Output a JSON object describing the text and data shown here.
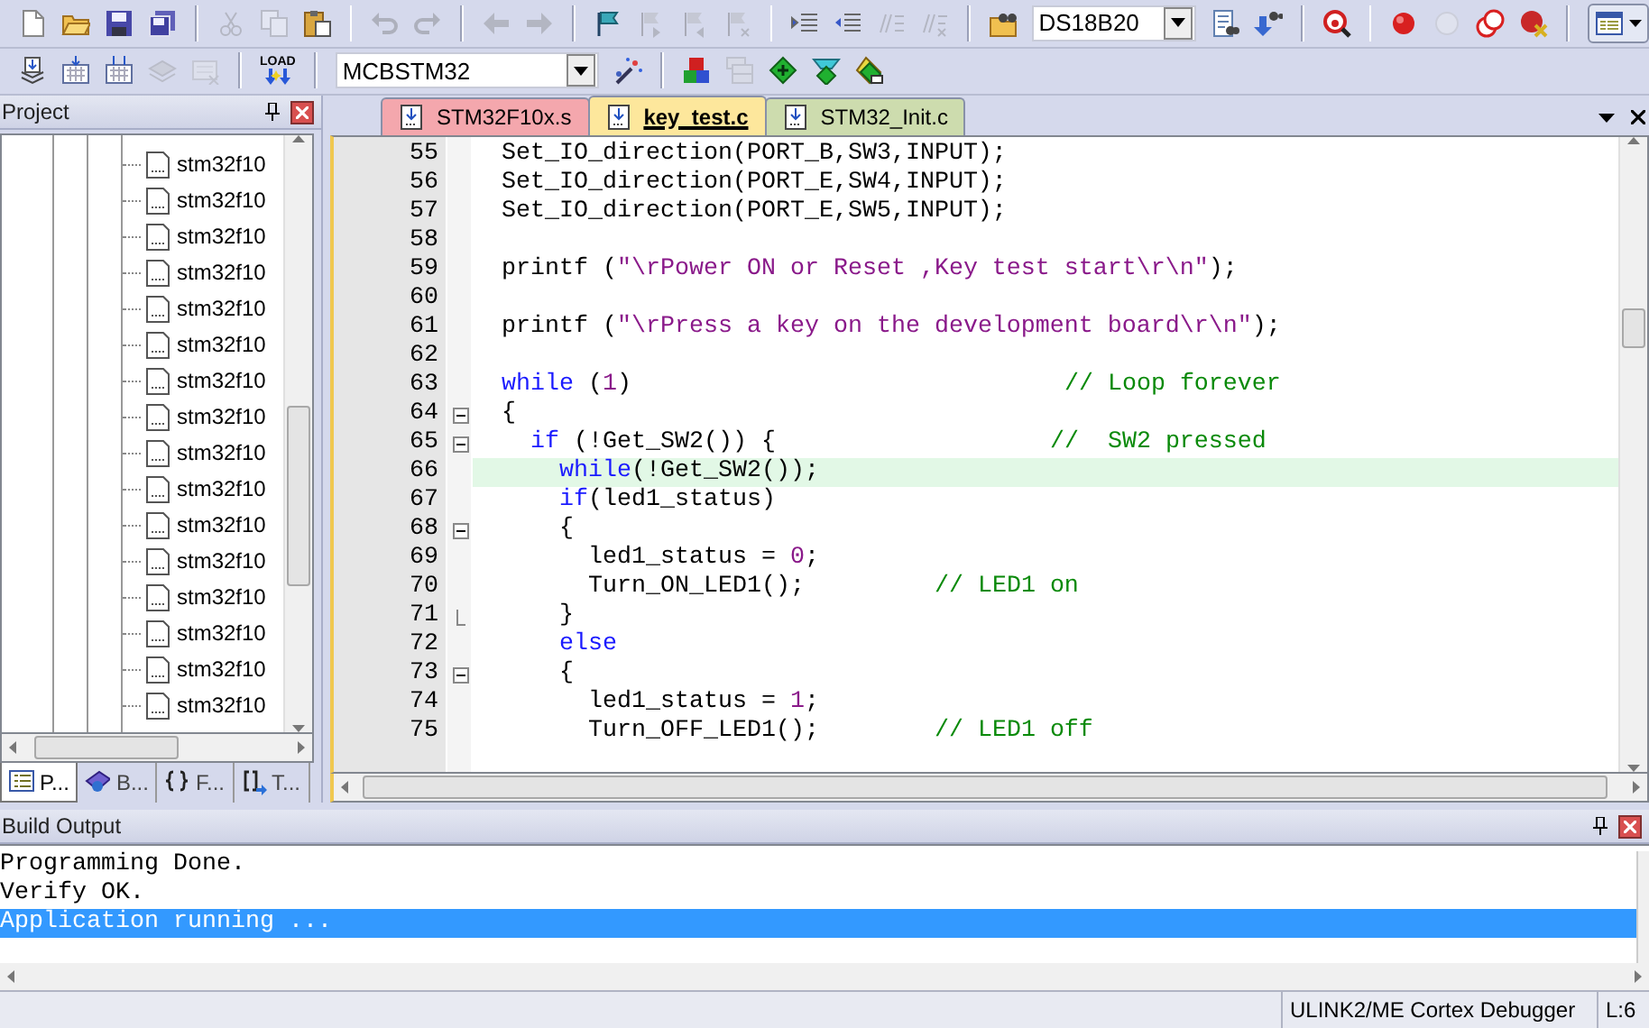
{
  "toolbar_1": {
    "items": [
      {
        "kind": "button",
        "disabled": false
      },
      {
        "kind": "button",
        "disabled": false
      },
      {
        "kind": "button",
        "disabled": false
      },
      {
        "kind": "button",
        "disabled": false
      },
      {
        "kind": "separator"
      },
      {
        "kind": "button",
        "disabled": true
      },
      {
        "kind": "button",
        "disabled": true
      },
      {
        "kind": "button",
        "disabled": false
      },
      {
        "kind": "separator"
      },
      {
        "kind": "button",
        "disabled": true
      },
      {
        "kind": "button",
        "disabled": true
      },
      {
        "kind": "separator"
      },
      {
        "kind": "button",
        "disabled": true
      },
      {
        "kind": "button",
        "disabled": true
      },
      {
        "kind": "separator"
      },
      {
        "kind": "button",
        "disabled": false
      },
      {
        "kind": "button",
        "disabled": true
      },
      {
        "kind": "button",
        "disabled": true
      },
      {
        "kind": "button",
        "disabled": true
      },
      {
        "kind": "separator"
      },
      {
        "kind": "button",
        "disabled": false
      },
      {
        "kind": "button",
        "disabled": false
      },
      {
        "kind": "button",
        "disabled": true
      },
      {
        "kind": "button",
        "disabled": true
      },
      {
        "kind": "separator"
      },
      {
        "kind": "button",
        "disabled": false
      },
      {
        "kind": "dropdown",
        "value": "DS18B20"
      },
      {
        "kind": "button",
        "disabled": false
      },
      {
        "kind": "button",
        "disabled": false
      },
      {
        "kind": "separator"
      },
      {
        "kind": "button",
        "disabled": false
      },
      {
        "kind": "separator"
      },
      {
        "kind": "button",
        "disabled": false
      },
      {
        "kind": "button",
        "disabled": true
      },
      {
        "kind": "button",
        "disabled": false
      },
      {
        "kind": "button",
        "disabled": false
      },
      {
        "kind": "separator"
      },
      {
        "kind": "menu_button",
        "disabled": false
      }
    ]
  },
  "toolbar_2": {
    "items": [
      {
        "kind": "button",
        "disabled": false
      },
      {
        "kind": "button",
        "disabled": false
      },
      {
        "kind": "button",
        "disabled": false
      },
      {
        "kind": "button",
        "disabled": true
      },
      {
        "kind": "button",
        "disabled": true
      },
      {
        "kind": "separator"
      },
      {
        "kind": "load",
        "label": "LOAD",
        "disabled": false
      },
      {
        "kind": "separator"
      },
      {
        "kind": "dropdown",
        "value": "MCBSTM32"
      },
      {
        "kind": "button",
        "disabled": false
      },
      {
        "kind": "separator"
      },
      {
        "kind": "button",
        "disabled": false
      },
      {
        "kind": "button",
        "disabled": true
      },
      {
        "kind": "button",
        "disabled": false
      },
      {
        "kind": "button",
        "disabled": false
      },
      {
        "kind": "button",
        "disabled": false
      }
    ]
  },
  "project": {
    "title": "Project",
    "items": [
      {
        "label": "stm32f10"
      },
      {
        "label": "stm32f10"
      },
      {
        "label": "stm32f10"
      },
      {
        "label": "stm32f10"
      },
      {
        "label": "stm32f10"
      },
      {
        "label": "stm32f10"
      },
      {
        "label": "stm32f10"
      },
      {
        "label": "stm32f10"
      },
      {
        "label": "stm32f10"
      },
      {
        "label": "stm32f10"
      },
      {
        "label": "stm32f10"
      },
      {
        "label": "stm32f10"
      },
      {
        "label": "stm32f10"
      },
      {
        "label": "stm32f10"
      },
      {
        "label": "stm32f10"
      },
      {
        "label": "stm32f10"
      }
    ],
    "tabs": [
      {
        "label": "P...",
        "selected": true
      },
      {
        "label": "B...",
        "selected": false
      },
      {
        "label": "F...",
        "selected": false
      },
      {
        "label": "T...",
        "selected": false
      }
    ]
  },
  "editor": {
    "tabs": [
      {
        "label": "STM32F10x.s",
        "color": "#f4a7ad",
        "selected": false
      },
      {
        "label": "key_test.c",
        "color": "#fde79c",
        "selected": true
      },
      {
        "label": "STM32_Init.c",
        "color": "#cddcae",
        "selected": false
      }
    ],
    "lines": [
      {
        "number": "55",
        "segments": [
          {
            "kind": "plain",
            "text": "  Set_IO_direction(PORT_B,SW3,INPUT);"
          }
        ]
      },
      {
        "number": "56",
        "segments": [
          {
            "kind": "plain",
            "text": "  Set_IO_direction(PORT_E,SW4,INPUT);"
          }
        ]
      },
      {
        "number": "57",
        "segments": [
          {
            "kind": "plain",
            "text": "  Set_IO_direction(PORT_E,SW5,INPUT);"
          }
        ]
      },
      {
        "number": "58"
      },
      {
        "number": "59",
        "segments": [
          {
            "kind": "plain",
            "text": "  printf ("
          },
          {
            "kind": "string",
            "text": "\"\\rPower ON or Reset ,Key test start\\r\\n\""
          },
          {
            "kind": "plain",
            "text": ");"
          }
        ]
      },
      {
        "number": "60"
      },
      {
        "number": "61",
        "segments": [
          {
            "kind": "plain",
            "text": "  printf ("
          },
          {
            "kind": "string",
            "text": "\"\\rPress a key on the development board\\r\\n\""
          },
          {
            "kind": "plain",
            "text": ");"
          }
        ]
      },
      {
        "number": "62"
      },
      {
        "number": "63",
        "segments": [
          {
            "kind": "keyword",
            "text": "  while"
          },
          {
            "kind": "plain",
            "text": " ("
          },
          {
            "kind": "number",
            "text": "1"
          },
          {
            "kind": "plain",
            "text": ")                              "
          },
          {
            "kind": "comment",
            "text": "// Loop forever"
          }
        ]
      },
      {
        "number": "64",
        "collapsible": true,
        "segments": [
          {
            "kind": "plain",
            "text": "  {"
          }
        ]
      },
      {
        "number": "65",
        "collapsible": true,
        "segments": [
          {
            "kind": "keyword",
            "text": "    if"
          },
          {
            "kind": "plain",
            "text": " (!Get_SW2()) {                   "
          },
          {
            "kind": "comment",
            "text": "//  SW2 pressed"
          }
        ]
      },
      {
        "number": "66",
        "current": true,
        "segments": [
          {
            "kind": "keyword",
            "text": "      while"
          },
          {
            "kind": "plain",
            "text": "(!Get_SW2());"
          }
        ]
      },
      {
        "number": "67",
        "segments": [
          {
            "kind": "keyword",
            "text": "      if"
          },
          {
            "kind": "plain",
            "text": "(led1_status)"
          }
        ]
      },
      {
        "number": "68",
        "collapsible": true,
        "segments": [
          {
            "kind": "plain",
            "text": "      {"
          }
        ]
      },
      {
        "number": "69",
        "segments": [
          {
            "kind": "plain",
            "text": "        led1_status = "
          },
          {
            "kind": "number",
            "text": "0"
          },
          {
            "kind": "plain",
            "text": ";"
          }
        ]
      },
      {
        "number": "70",
        "segments": [
          {
            "kind": "plain",
            "text": "        Turn_ON_LED1();         "
          },
          {
            "kind": "comment",
            "text": "// LED1 on"
          }
        ]
      },
      {
        "number": "71",
        "block_end": true,
        "segments": [
          {
            "kind": "plain",
            "text": "      }"
          }
        ]
      },
      {
        "number": "72",
        "segments": [
          {
            "kind": "keyword",
            "text": "      else"
          }
        ]
      },
      {
        "number": "73",
        "collapsible": true,
        "segments": [
          {
            "kind": "plain",
            "text": "      {"
          }
        ]
      },
      {
        "number": "74",
        "segments": [
          {
            "kind": "plain",
            "text": "        led1_status = "
          },
          {
            "kind": "number",
            "text": "1"
          },
          {
            "kind": "plain",
            "text": ";"
          }
        ]
      },
      {
        "number": "75",
        "segments": [
          {
            "kind": "plain",
            "text": "        Turn_OFF_LED1();        "
          },
          {
            "kind": "comment",
            "text": "// LED1 off"
          }
        ]
      }
    ]
  },
  "build_output": {
    "title": "Build Output",
    "lines": [
      {
        "text": "Programming Done.",
        "selected": false
      },
      {
        "text": "Verify OK.",
        "selected": false
      },
      {
        "text": "Application running ...",
        "selected": true
      }
    ]
  },
  "status_bar": {
    "debugger": "ULINK2/ME Cortex Debugger",
    "position": "L:6"
  }
}
